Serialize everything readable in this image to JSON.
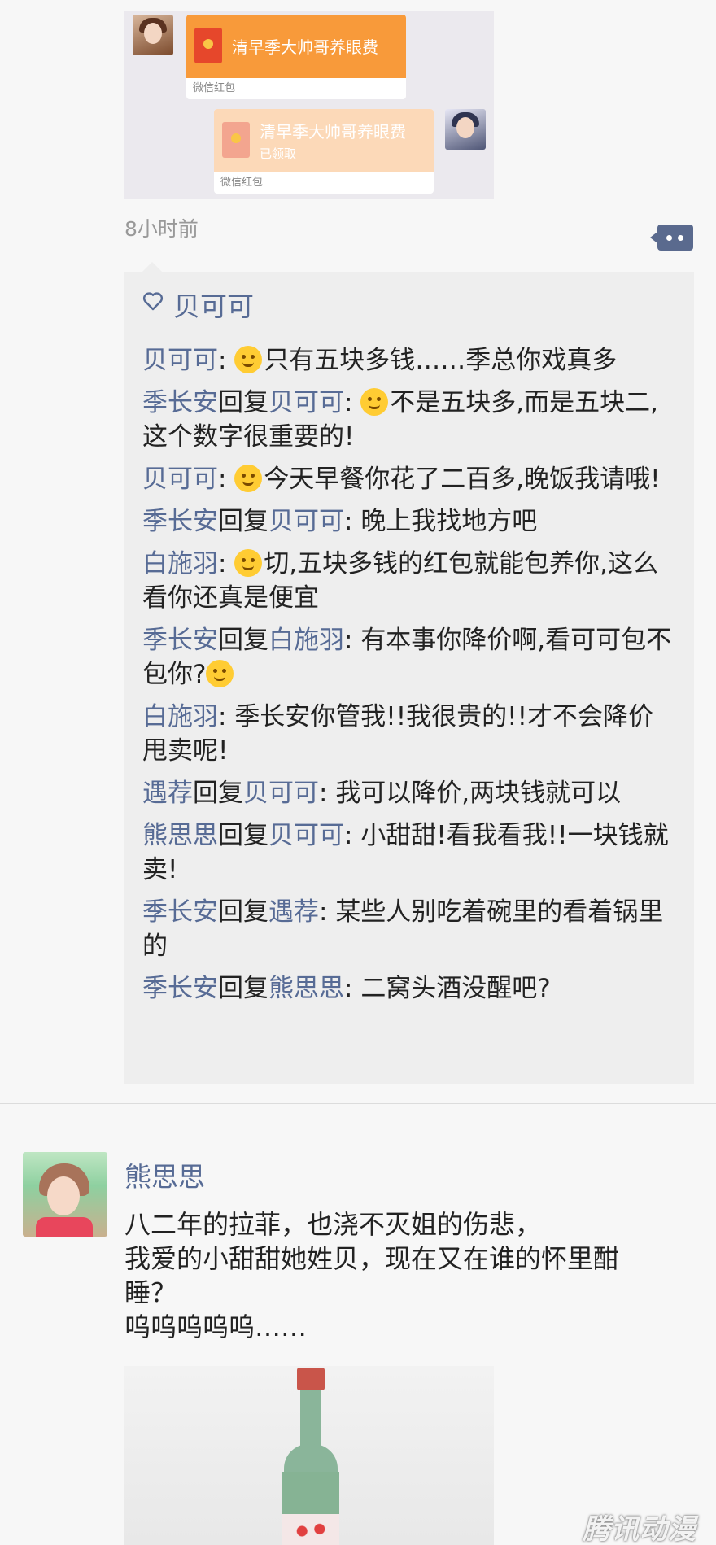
{
  "post1": {
    "image": {
      "packet1_title": "清早季大帅哥养眼费",
      "packet1_footer": "微信红包",
      "packet2_title": "清早季大帅哥养眼费",
      "packet2_status": "已领取",
      "packet2_footer": "微信红包"
    },
    "time": "8小时前",
    "likes": [
      "贝可可"
    ],
    "comments": [
      {
        "author": "贝可可",
        "reply_to": null,
        "emoji": "laugh-cry",
        "text": "只有五块多钱……季总你戏真多"
      },
      {
        "author": "季长安",
        "reply_to": "贝可可",
        "emoji": "wink",
        "text": "不是五块多,而是五块二,这个数字很重要的!"
      },
      {
        "author": "贝可可",
        "reply_to": null,
        "emoji": "smile",
        "text": "今天早餐你花了二百多,晚饭我请哦!"
      },
      {
        "author": "季长安",
        "reply_to": "贝可可",
        "emoji": null,
        "text": "晚上我找地方吧"
      },
      {
        "author": "白施羽",
        "reply_to": null,
        "emoji": "unamused",
        "text": "切,五块多钱的红包就能包养你,这么看你还真是便宜"
      },
      {
        "author": "季长安",
        "reply_to": "白施羽",
        "emoji": null,
        "text": "有本事你降价啊,看可可包不包你?",
        "trail_emoji": "tongue"
      },
      {
        "author": "白施羽",
        "reply_to": null,
        "emoji": null,
        "text": "季长安你管我!!我很贵的!!才不会降价甩卖呢!"
      },
      {
        "author": "遇荐",
        "reply_to": "贝可可",
        "emoji": null,
        "text": "我可以降价,两块钱就可以"
      },
      {
        "author": "熊思思",
        "reply_to": "贝可可",
        "emoji": null,
        "text": "小甜甜!看我看我!!一块钱就卖!"
      },
      {
        "author": "季长安",
        "reply_to": "遇荐",
        "emoji": null,
        "text": "某些人别吃着碗里的看着锅里的"
      },
      {
        "author": "季长安",
        "reply_to": "熊思思",
        "emoji": null,
        "text": "二窝头酒没醒吧?"
      }
    ],
    "reply_word": "回复"
  },
  "post2": {
    "author": "熊思思",
    "lines": [
      "八二年的拉菲，也浇不灭姐的伤悲，",
      "我爱的小甜甜她姓贝，现在又在谁的怀里酣",
      "睡？",
      "呜呜呜呜呜……"
    ]
  },
  "watermark": "腾讯动漫",
  "colors": {
    "name_blue": "#576b95",
    "packet_orange": "#f89a3a",
    "packet_received": "#fcd9b8",
    "comment_bg": "#eeeeee"
  }
}
